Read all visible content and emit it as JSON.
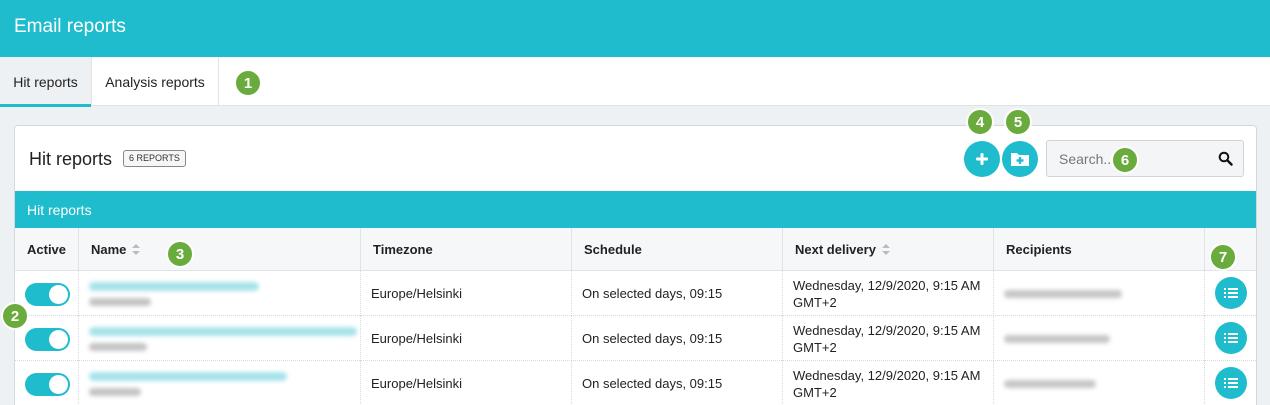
{
  "header": {
    "title": "Email reports"
  },
  "tabs": [
    {
      "label": "Hit reports",
      "active": true
    },
    {
      "label": "Analysis reports",
      "active": false
    }
  ],
  "panel": {
    "title": "Hit reports",
    "count_badge": "6 REPORTS",
    "section_label": "Hit reports",
    "search_placeholder": "Search..."
  },
  "table": {
    "columns": [
      "Active",
      "Name",
      "Timezone",
      "Schedule",
      "Next delivery",
      "Recipients"
    ],
    "rows": [
      {
        "active": true,
        "timezone": "Europe/Helsinki",
        "schedule": "On selected days, 09:15",
        "next_delivery_line1": "Wednesday, 12/9/2020, 9:15 AM",
        "next_delivery_line2": "GMT+2"
      },
      {
        "active": true,
        "timezone": "Europe/Helsinki",
        "schedule": "On selected days, 09:15",
        "next_delivery_line1": "Wednesday, 12/9/2020, 9:15 AM",
        "next_delivery_line2": "GMT+2"
      },
      {
        "active": true,
        "timezone": "Europe/Helsinki",
        "schedule": "On selected days, 09:15",
        "next_delivery_line1": "Wednesday, 12/9/2020, 9:15 AM",
        "next_delivery_line2": "GMT+2"
      }
    ]
  },
  "markers": [
    "1",
    "2",
    "3",
    "4",
    "5",
    "6",
    "7"
  ],
  "icons": {
    "add": "plus-icon",
    "add_folder": "folder-plus-icon",
    "search": "search-icon",
    "sort": "sort-icon",
    "row_action": "list-icon"
  },
  "colors": {
    "accent": "#1fbccd",
    "marker": "#6aab3e"
  }
}
